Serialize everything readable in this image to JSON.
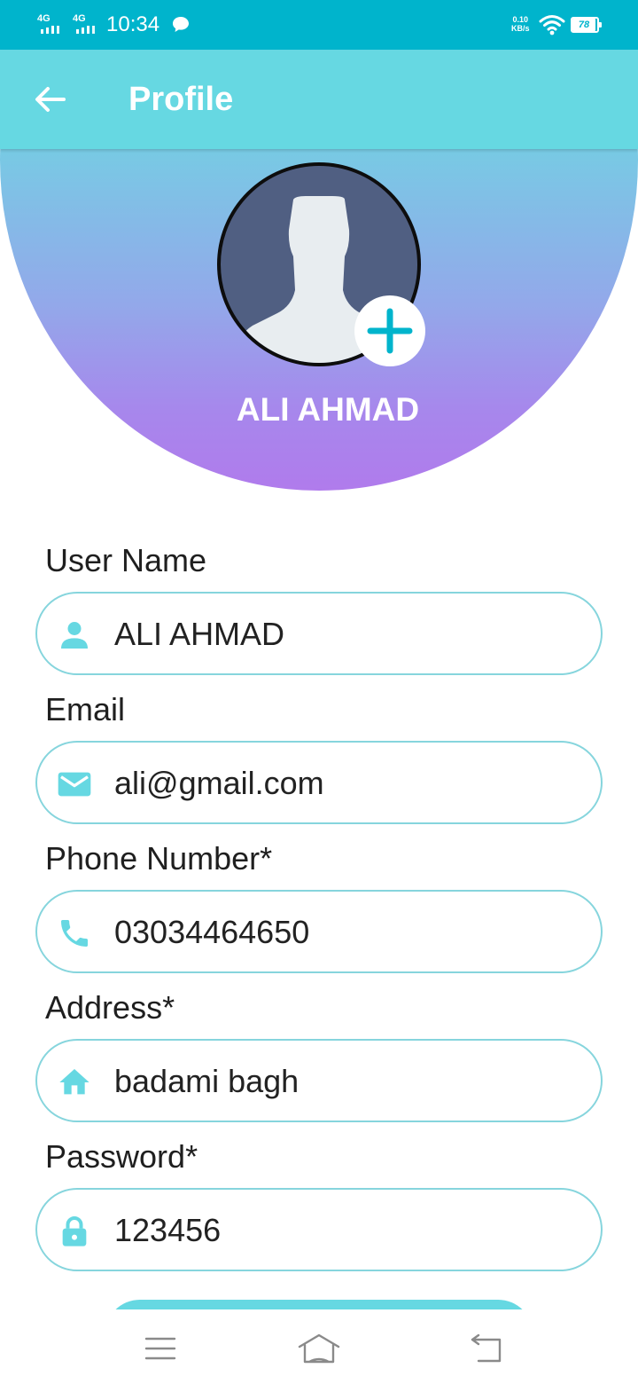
{
  "status_bar": {
    "signal1_label": "4G",
    "signal2_label": "4G",
    "time": "10:34",
    "net_speed_value": "0.10",
    "net_speed_unit": "KB/s",
    "battery": "78"
  },
  "header": {
    "title": "Profile"
  },
  "profile": {
    "display_name": "ALI AHMAD"
  },
  "form": {
    "username_label": "User Name",
    "username_value": "ALI AHMAD",
    "email_label": "Email",
    "email_value": "ali@gmail.com",
    "phone_label": "Phone Number*",
    "phone_value": "03034464650",
    "address_label": "Address*",
    "address_value": "badami bagh",
    "password_label": "Password*",
    "password_value": "123456"
  },
  "icons": {
    "back": "arrow-back-icon",
    "add_photo": "plus-icon",
    "username": "person-icon",
    "email": "mail-icon",
    "phone": "phone-icon",
    "address": "home-icon",
    "password": "lock-icon",
    "nav_menu": "menu-icon",
    "nav_home": "home-outline-icon",
    "nav_back": "return-icon"
  },
  "colors": {
    "status_bar": "#00b4cc",
    "header": "#66d8e2",
    "accent": "#00b4cc",
    "field_border": "#86d5dd",
    "gradient_top": "#6fd4e2",
    "gradient_bottom": "#b07bec"
  }
}
